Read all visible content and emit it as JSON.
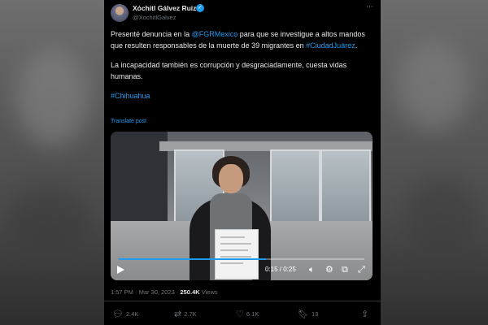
{
  "author": {
    "name": "Xóchitl Gálvez Ruiz",
    "handle": "@XochitlGalvez",
    "verified_mark": "✓"
  },
  "post": {
    "line1_start": "Presenté denuncia en la ",
    "mention": "@FGRMexico",
    "line1_end": " para que se investigue a altos mandos que resulten responsables de la muerte de 39 migrantes en ",
    "hashtag_city": "#CiudadJuárez",
    "line1_tail": ".",
    "paragraph2": "La incapacidad también es corrupción y desgraciadamente, cuesta vidas humanas.",
    "hashtag_state": "#Chihuahua",
    "translate_label": "Translate post"
  },
  "video": {
    "timecode": "0:15 / 0:25",
    "progress_fraction": 0.6,
    "accent": "#1d9bf0"
  },
  "meta": {
    "time": "1:57 PM · Mar 30, 2023 · ",
    "views_count": "250.4K",
    "views_label": " Views"
  },
  "actions": {
    "replies": "2.4K",
    "reposts": "2.7K",
    "likes": "6.1K",
    "bookmarks": "13"
  },
  "icons": [
    "more-icon",
    "verified-icon",
    "play-icon",
    "volume-icon",
    "settings-icon",
    "pip-icon",
    "fullscreen-icon",
    "reply-icon",
    "repost-icon",
    "like-icon",
    "bookmark-icon",
    "share-icon"
  ]
}
